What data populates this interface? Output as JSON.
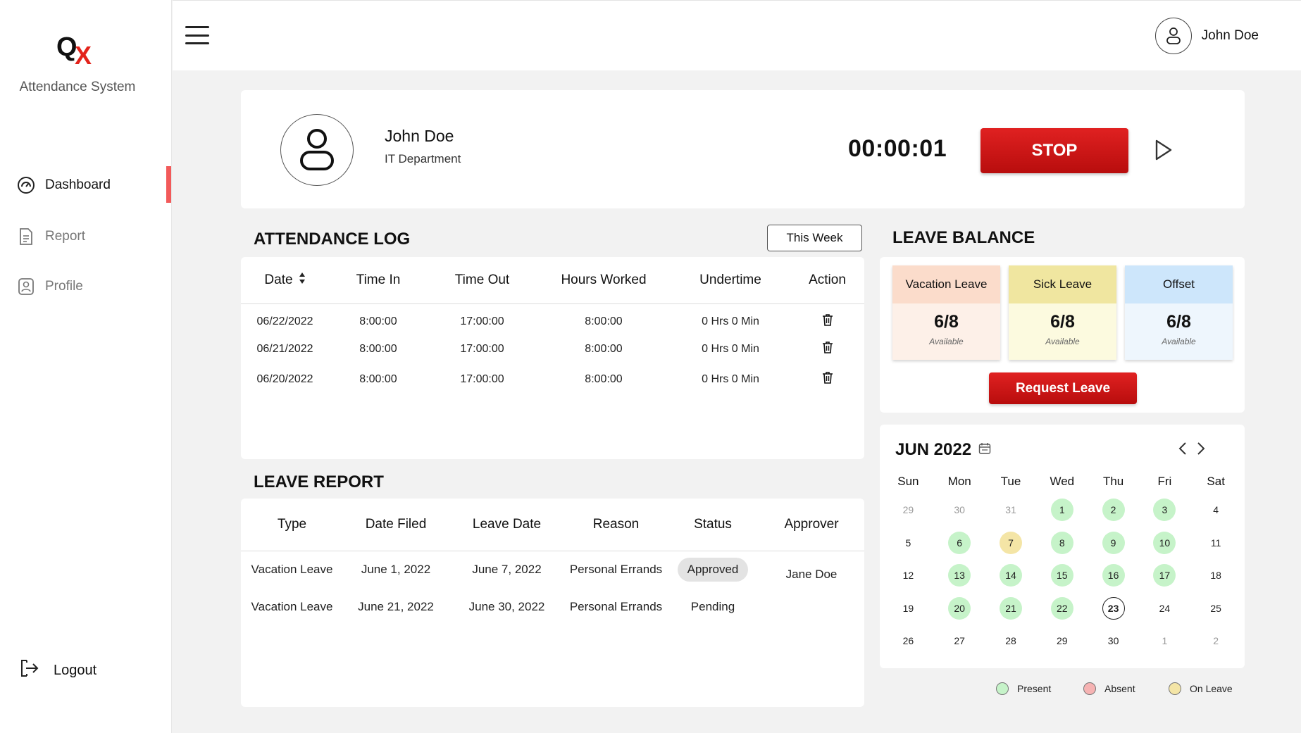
{
  "app": {
    "title": "Attendance System",
    "logo_q": "Q",
    "logo_x": "X"
  },
  "sidebar": {
    "items": [
      {
        "label": "Dashboard",
        "icon": "gauge-icon"
      },
      {
        "label": "Report",
        "icon": "document-icon"
      },
      {
        "label": "Profile",
        "icon": "profile-icon"
      }
    ],
    "logout_label": "Logout"
  },
  "topbar": {
    "username": "John Doe"
  },
  "profile": {
    "name": "John Doe",
    "department": "IT Department",
    "timer": "00:00:01",
    "stop_label": "STOP"
  },
  "attendance": {
    "title": "ATTENDANCE LOG",
    "filter_label": "This Week",
    "columns": [
      "Date",
      "Time In",
      "Time Out",
      "Hours Worked",
      "Undertime",
      "Action"
    ],
    "rows": [
      {
        "date": "06/22/2022",
        "time_in": "8:00:00",
        "time_out": "17:00:00",
        "hours": "8:00:00",
        "undertime": "0 Hrs 0 Min"
      },
      {
        "date": "06/21/2022",
        "time_in": "8:00:00",
        "time_out": "17:00:00",
        "hours": "8:00:00",
        "undertime": "0 Hrs 0 Min"
      },
      {
        "date": "06/20/2022",
        "time_in": "8:00:00",
        "time_out": "17:00:00",
        "hours": "8:00:00",
        "undertime": "0 Hrs 0 Min"
      }
    ]
  },
  "leave_report": {
    "title": "LEAVE REPORT",
    "columns": [
      "Type",
      "Date Filed",
      "Leave Date",
      "Reason",
      "Status",
      "Approver"
    ],
    "rows": [
      {
        "type": "Vacation Leave",
        "filed": "June 1, 2022",
        "leave_date": "June 7, 2022",
        "reason": "Personal Errands",
        "status": "Approved",
        "approver": "Jane Doe"
      },
      {
        "type": "Vacation Leave",
        "filed": "June 21, 2022",
        "leave_date": "June 30, 2022",
        "reason": "Personal Errands",
        "status": "Pending",
        "approver": ""
      }
    ]
  },
  "leave_balance": {
    "title": "LEAVE BALANCE",
    "items": [
      {
        "label": "Vacation Leave",
        "value": "6/8",
        "sub": "Available",
        "head_color": "#fbdccb",
        "body_color": "#fdf0e8"
      },
      {
        "label": "Sick Leave",
        "value": "6/8",
        "sub": "Available",
        "head_color": "#f0e6a0",
        "body_color": "#fcfadf"
      },
      {
        "label": "Offset",
        "value": "6/8",
        "sub": "Available",
        "head_color": "#cde6fb",
        "body_color": "#eef6fd"
      }
    ],
    "request_label": "Request Leave"
  },
  "calendar": {
    "title": "JUN 2022",
    "weekdays": [
      "Sun",
      "Mon",
      "Tue",
      "Wed",
      "Thu",
      "Fri",
      "Sat"
    ],
    "weeks": [
      [
        {
          "d": "29",
          "s": "muted"
        },
        {
          "d": "30",
          "s": "muted"
        },
        {
          "d": "31",
          "s": "muted"
        },
        {
          "d": "1",
          "s": "present"
        },
        {
          "d": "2",
          "s": "present"
        },
        {
          "d": "3",
          "s": "present"
        },
        {
          "d": "4",
          "s": ""
        }
      ],
      [
        {
          "d": "5",
          "s": ""
        },
        {
          "d": "6",
          "s": "present"
        },
        {
          "d": "7",
          "s": "leave"
        },
        {
          "d": "8",
          "s": "present"
        },
        {
          "d": "9",
          "s": "present"
        },
        {
          "d": "10",
          "s": "present"
        },
        {
          "d": "11",
          "s": ""
        }
      ],
      [
        {
          "d": "12",
          "s": ""
        },
        {
          "d": "13",
          "s": "present"
        },
        {
          "d": "14",
          "s": "present"
        },
        {
          "d": "15",
          "s": "present"
        },
        {
          "d": "16",
          "s": "present"
        },
        {
          "d": "17",
          "s": "present"
        },
        {
          "d": "18",
          "s": ""
        }
      ],
      [
        {
          "d": "19",
          "s": ""
        },
        {
          "d": "20",
          "s": "present"
        },
        {
          "d": "21",
          "s": "present"
        },
        {
          "d": "22",
          "s": "present"
        },
        {
          "d": "23",
          "s": "today"
        },
        {
          "d": "24",
          "s": ""
        },
        {
          "d": "25",
          "s": ""
        }
      ],
      [
        {
          "d": "26",
          "s": ""
        },
        {
          "d": "27",
          "s": ""
        },
        {
          "d": "28",
          "s": ""
        },
        {
          "d": "29",
          "s": ""
        },
        {
          "d": "30",
          "s": ""
        },
        {
          "d": "1",
          "s": "muted"
        },
        {
          "d": "2",
          "s": "muted"
        }
      ]
    ],
    "legend": [
      {
        "label": "Present",
        "color": "#c6f3c9"
      },
      {
        "label": "Absent",
        "color": "#f6b3b3"
      },
      {
        "label": "On Leave",
        "color": "#f4e5a6"
      }
    ]
  },
  "colors": {
    "accent": "#d11818",
    "active_indicator": "#f25a5a"
  }
}
